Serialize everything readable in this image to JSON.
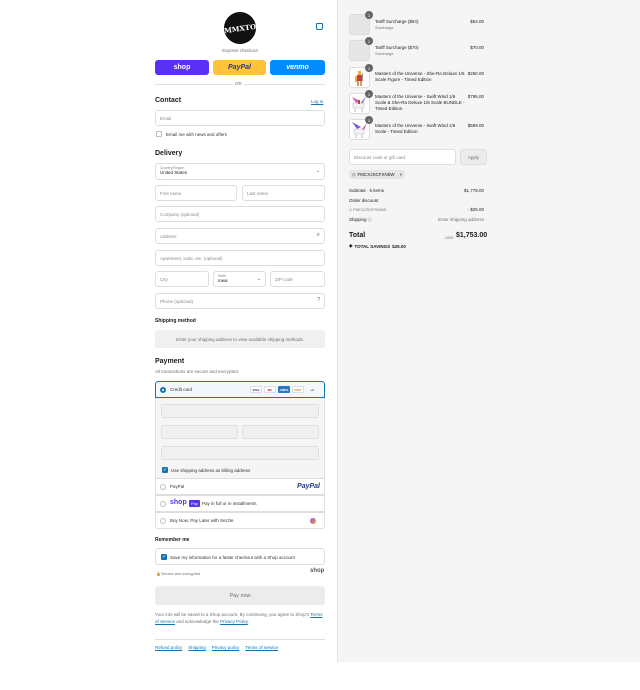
{
  "brand": {
    "logo_text": "MMXTO"
  },
  "express": {
    "label": "Express checkout",
    "shop": "shop",
    "paypal": "PayPal",
    "venmo": "venmo",
    "or": "OR"
  },
  "contact": {
    "title": "Contact",
    "login": "Log in",
    "email_placeholder": "Email",
    "newsletter": "Email me with news and offers"
  },
  "delivery": {
    "title": "Delivery",
    "country_label": "Country/Region",
    "country_value": "United States",
    "first_name": "First name",
    "last_name": "Last name",
    "company": "Company (optional)",
    "address": "Address",
    "apartment": "Apartment, suite, etc. (optional)",
    "city": "City",
    "state_label": "State",
    "state_value": "Iowa",
    "zip": "ZIP code",
    "phone": "Phone (optional)"
  },
  "shipping": {
    "title": "Shipping method",
    "notice": "Enter your shipping address to view available shipping methods."
  },
  "payment": {
    "title": "Payment",
    "subtitle": "All transactions are secure and encrypted.",
    "credit_card": "Credit card",
    "more_cards": "+4",
    "card_brands": [
      "VISA",
      "MC",
      "AMEX",
      "DISC"
    ],
    "billing_same": "Use shipping address as billing address",
    "paypal": "PayPal",
    "paypal_logo": "PayPal",
    "shoppay_logo": "shop",
    "shoppay_badge": "Pay",
    "shoppay_text": "Pay in full or in installments",
    "sezzle": "Buy Now, Pay Later with Sezzle"
  },
  "remember": {
    "title": "Remember me",
    "save_info": "Save my information for a faster checkout with a Shop account",
    "secure": "Secure and encrypted",
    "shop_logo": "shop"
  },
  "pay_now": "Pay now",
  "legal": {
    "line1": "Your info will be saved to a Shop account. By continuing, you agree to Shop's",
    "tos": "Terms of Service",
    "and": "and acknowledge the",
    "privacy": "Privacy Policy",
    "end": "."
  },
  "footer": [
    "Refund policy",
    "Shipping",
    "Privacy policy",
    "Terms of service"
  ],
  "cart": {
    "items": [
      {
        "name": "Tariff Surcharge ($54)",
        "sub": "Surcharge",
        "price": "$54.00",
        "qty": "1"
      },
      {
        "name": "Tariff Surcharge ($70)",
        "sub": "Surcharge",
        "price": "$70.00",
        "qty": "1"
      },
      {
        "name": "Masters of the Universe - She-Ra Deluxe 1/6 Scale Figure - Timed Edition",
        "sub": "",
        "price": "$260.00",
        "qty": "1"
      },
      {
        "name": "Masters of the Universe - Swift Wind 1/6 Scale & She-Ra Deluxe 1/6 Scale BUNDLE - Timed Edition",
        "sub": "",
        "price": "$795.00",
        "qty": "1"
      },
      {
        "name": "Masters of the Universe - Swift Wind 1/6 Scale - Timed Edition",
        "sub": "",
        "price": "$599.00",
        "qty": "1"
      }
    ],
    "discount_placeholder": "Discount code or gift card",
    "apply": "Apply",
    "code_chip": "FMCXJSCFXN5W",
    "subtotal_label": "Subtotal · 5 items",
    "subtotal_value": "$1,778.00",
    "order_discount_label": "Order discount",
    "discount_code": "FMCXJSCFXN5W",
    "discount_value": "- $25.00",
    "shipping_label": "Shipping",
    "shipping_value": "Enter shipping address",
    "total_label": "Total",
    "currency": "USD",
    "total_value": "$1,753.00",
    "savings_label": "TOTAL SAVINGS",
    "savings_value": "$25.00"
  },
  "colors": {
    "accent": "#1773b0",
    "shop_purple": "#5a31f4",
    "paypal_yellow": "#ffc439",
    "venmo_blue": "#008cff"
  }
}
